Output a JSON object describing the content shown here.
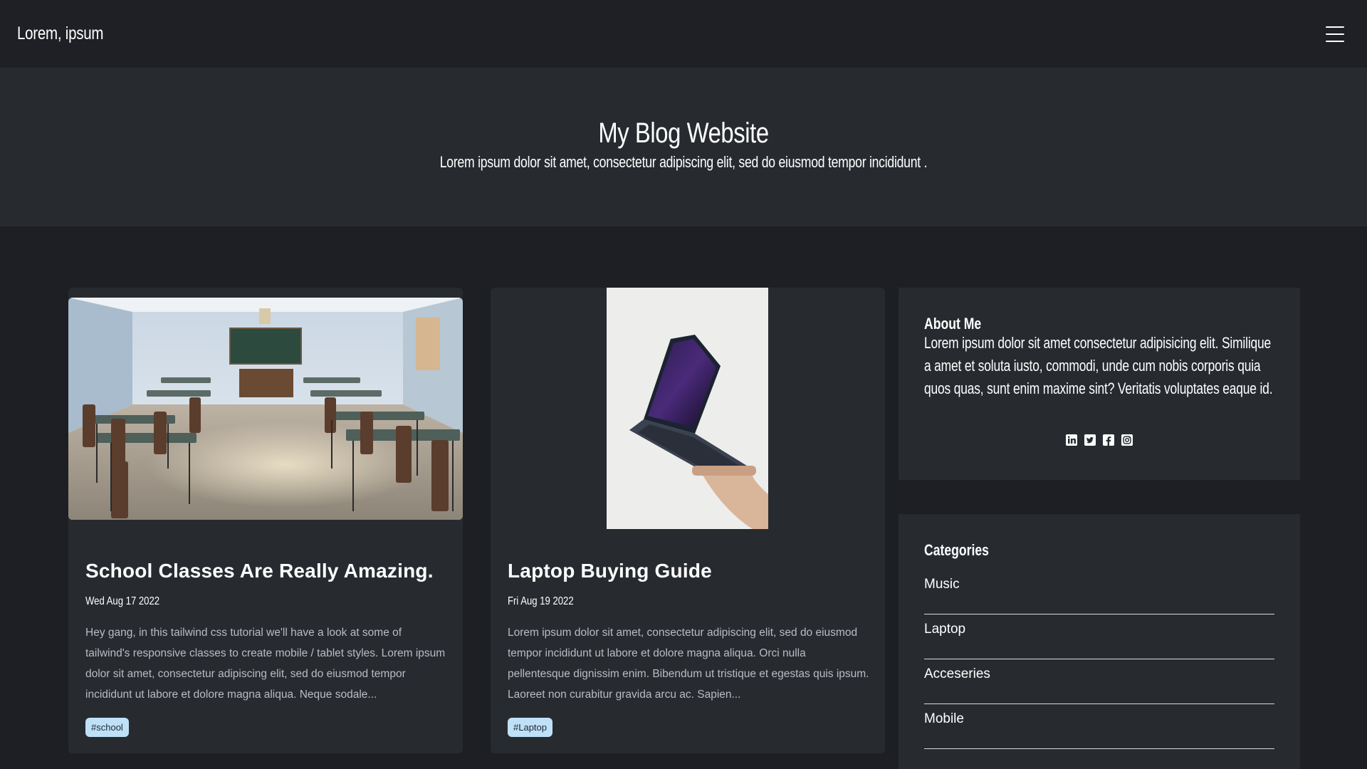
{
  "navbar": {
    "brand": "Lorem, ipsum",
    "menu_icon": "hamburger-menu-icon"
  },
  "hero": {
    "title": "My Blog Website",
    "subtitle": "Lorem ipsum dolor sit amet, consectetur adipiscing elit, sed do eiusmod tempor incididunt ."
  },
  "posts": [
    {
      "title": "School Classes Are Really Amazing.",
      "date": "Wed Aug 17 2022",
      "excerpt": "Hey gang, in this tailwind css tutorial we'll have a look at some of tailwind's responsive classes to create mobile / tablet styles. Lorem ipsum dolor sit amet, consectetur adipiscing elit, sed do eiusmod tempor incididunt ut labore et dolore magna aliqua. Neque sodale...",
      "tag": "#school",
      "image": "classroom-photo"
    },
    {
      "title": "Laptop Buying Guide",
      "date": "Fri Aug 19 2022",
      "excerpt": "Lorem ipsum dolor sit amet, consectetur adipiscing elit, sed do eiusmod tempor incididunt ut labore et dolore magna aliqua. Orci nulla pellentesque dignissim enim. Bibendum ut tristique et egestas quis ipsum. Laoreet non curabitur gravida arcu ac. Sapien...",
      "tag": "#Laptop",
      "image": "laptop-photo"
    }
  ],
  "about": {
    "title": "About Me",
    "text": "Lorem ipsum dolor sit amet consectetur adipisicing elit. Similique a amet et soluta iusto, commodi, unde cum nobis corporis quia quos quas, sunt enim maxime sint? Veritatis voluptates eaque id.",
    "socials": [
      "linkedin-icon",
      "twitter-icon",
      "facebook-icon",
      "instagram-icon"
    ]
  },
  "categories": {
    "title": "Categories",
    "items": [
      "Music",
      "Laptop",
      "Acceseries",
      "Mobile"
    ]
  },
  "colors": {
    "background": "#1d1f24",
    "panel": "#272b30",
    "tag_bg": "#bfe1f7"
  }
}
